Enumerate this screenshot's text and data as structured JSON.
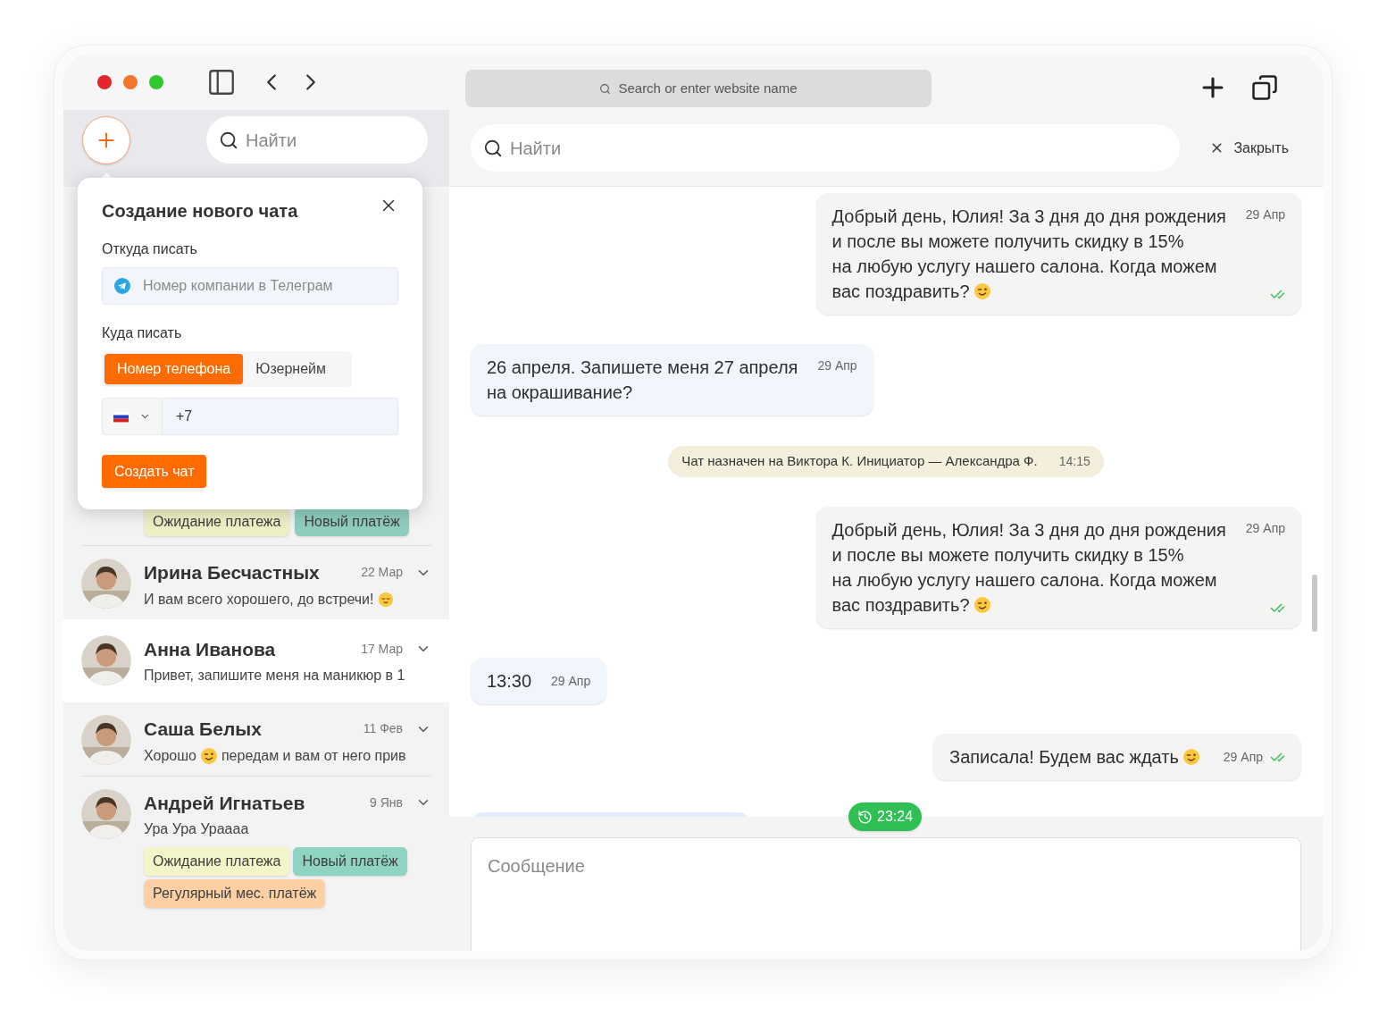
{
  "browser": {
    "address_placeholder": "Search or enter website name"
  },
  "sidebar": {
    "search": {
      "placeholder": "Найти"
    },
    "chats": [
      {
        "selected": false,
        "tags": [
          {
            "label": "Ожидание платежа",
            "color": "#efefc6"
          },
          {
            "label": "Новый платёж",
            "color": "#8fcdbf"
          }
        ]
      },
      {
        "selected": false,
        "name": "Ирина Бесчастных",
        "date": "22 Мар",
        "preview": [
          {
            "kind": "text",
            "text": "И вам всего хорошего, до встречи!"
          },
          {
            "kind": "calm_emoji"
          }
        ]
      },
      {
        "selected": true,
        "name": "Анна Иванова",
        "date": "17 Мар",
        "preview": [
          {
            "kind": "text",
            "text": "Привет, запишите меня на маникюр в 1"
          }
        ]
      },
      {
        "selected": false,
        "name": "Саша Белых",
        "date": "11 Фев",
        "preview": [
          {
            "kind": "text",
            "text": "Хорошо"
          },
          {
            "kind": "wink_emoji"
          },
          {
            "kind": "text",
            "text": "передам и вам от него прив"
          }
        ]
      },
      {
        "selected": false,
        "name": "Андрей Игнатьев",
        "date": "9 Янв",
        "preview": [
          {
            "kind": "text",
            "text": "Ура Ура Ураааа"
          }
        ],
        "tags": [
          {
            "label": "Ожидание платежа",
            "color": "#f3f5c9"
          },
          {
            "label": "Новый платёж",
            "color": "#8fd3c3"
          },
          {
            "label": "Регулярный мес. платёж",
            "color": "#fcd0a4"
          }
        ]
      }
    ]
  },
  "new_chat_popup": {
    "title": "Создание нового чата",
    "from_label": "Откуда писать",
    "from_placeholder": "Номер компании в Телеграм",
    "to_label": "Куда писать",
    "modes": [
      {
        "label": "Номер телефона",
        "selected": true
      },
      {
        "label": "Юзернейм",
        "selected": false
      }
    ],
    "phone_value": "+7",
    "submit": "Создать чат"
  },
  "chat": {
    "search": {
      "placeholder": "Найти"
    },
    "close": "Закрыть",
    "messages": [
      {
        "kind": "outgoing",
        "lines": [
          "Добрый день, Юлия! За 3 дня до дня рождения",
          "и после вы можете получить скидку в 15%",
          "на любую услугу нашего салона. Когда можем",
          "вас поздравить?"
        ],
        "emoji": true,
        "time": "29 Апр",
        "read": true
      },
      {
        "kind": "incoming",
        "lines": [
          "26 апреля. Запишете меня 27 апреля",
          "на окрашивание?"
        ],
        "time": "29 Апр"
      },
      {
        "kind": "system",
        "lines": [
          "Чат назначен на Виктора К. Инициатор — Александра Ф."
        ],
        "time": "14:15"
      },
      {
        "kind": "outgoing",
        "lines": [
          "Добрый день, Юлия! За 3 дня до дня рождения",
          "и после вы можете получить скидку в 15%",
          "на любую услугу нашего салона. Когда можем",
          "вас поздравить?"
        ],
        "emoji": true,
        "time": "29 Апр",
        "read": true
      },
      {
        "kind": "incoming",
        "lines": [
          "13:30"
        ],
        "time": "29 Апр"
      },
      {
        "kind": "outgoing",
        "lines": [
          "Записала! Будем вас ждать"
        ],
        "emoji": true,
        "time": "29 Апр",
        "read": true
      }
    ],
    "timer": "23:24",
    "composer": {
      "placeholder": "Сообщение"
    }
  }
}
